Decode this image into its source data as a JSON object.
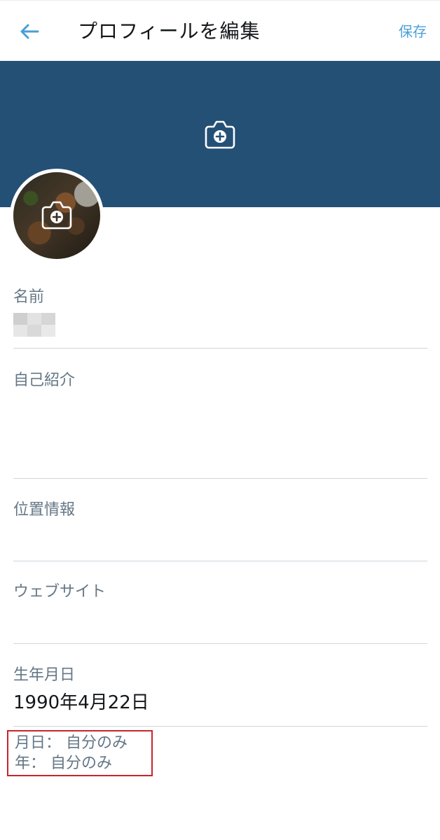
{
  "header": {
    "title": "プロフィールを編集",
    "save_label": "保存"
  },
  "fields": {
    "name": {
      "label": "名前",
      "value": ""
    },
    "bio": {
      "label": "自己紹介",
      "value": ""
    },
    "location": {
      "label": "位置情報",
      "value": ""
    },
    "website": {
      "label": "ウェブサイト",
      "value": ""
    },
    "birthday": {
      "label": "生年月日",
      "value": "1990年4月22日"
    }
  },
  "privacy": {
    "month_day": "月日： 自分のみ",
    "year": "年： 自分のみ"
  },
  "colors": {
    "accent": "#4a9fd8",
    "banner": "#245076",
    "highlight_border": "#c8242c"
  },
  "icons": {
    "back": "arrow-left-icon",
    "camera": "camera-plus-icon"
  }
}
